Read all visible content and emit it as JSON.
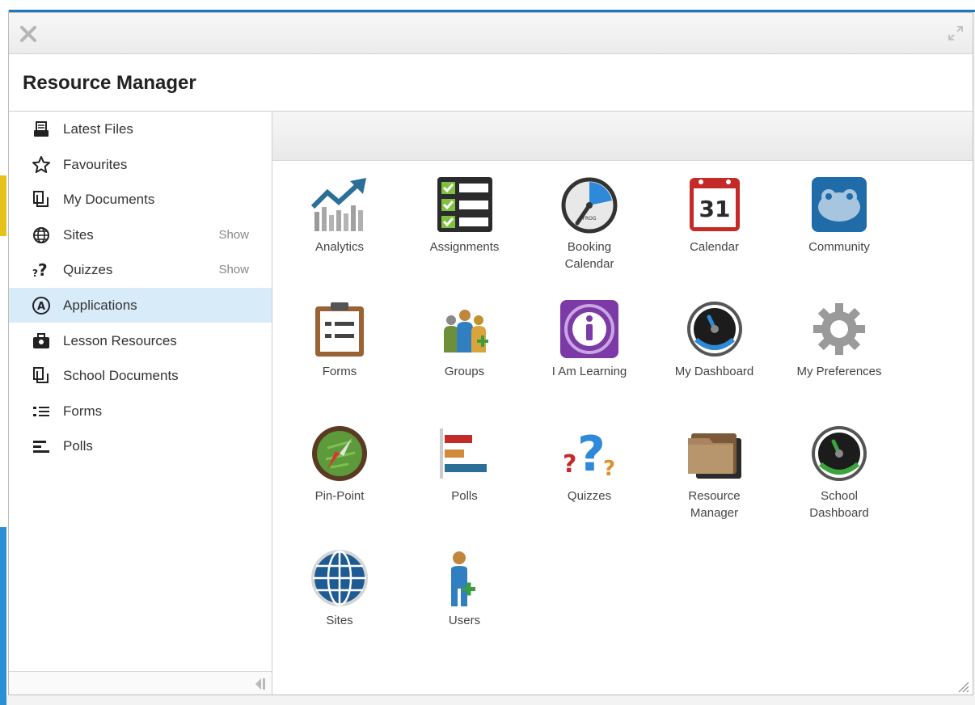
{
  "window": {
    "title": "Resource Manager"
  },
  "sidebar": {
    "items": [
      {
        "label": "Latest Files",
        "icon": "latest-files-icon"
      },
      {
        "label": "Favourites",
        "icon": "star-icon"
      },
      {
        "label": "My Documents",
        "icon": "documents-icon"
      },
      {
        "label": "Sites",
        "icon": "globe-icon",
        "action": "Show"
      },
      {
        "label": "Quizzes",
        "icon": "quiz-icon",
        "action": "Show"
      },
      {
        "label": "Applications",
        "icon": "applications-icon",
        "active": true
      },
      {
        "label": "Lesson Resources",
        "icon": "briefcase-icon"
      },
      {
        "label": "School Documents",
        "icon": "documents-icon"
      },
      {
        "label": "Forms",
        "icon": "list-icon"
      },
      {
        "label": "Polls",
        "icon": "polls-icon"
      }
    ]
  },
  "apps": [
    {
      "label": "Analytics",
      "icon": "analytics-icon"
    },
    {
      "label": "Assignments",
      "icon": "assignments-icon"
    },
    {
      "label": "Booking Calendar",
      "icon": "booking-calendar-icon"
    },
    {
      "label": "Calendar",
      "icon": "calendar-icon",
      "badge": "31"
    },
    {
      "label": "Community",
      "icon": "community-icon"
    },
    {
      "label": "Forms",
      "icon": "forms-icon"
    },
    {
      "label": "Groups",
      "icon": "groups-icon"
    },
    {
      "label": "I Am Learning",
      "icon": "i-am-learning-icon"
    },
    {
      "label": "My Dashboard",
      "icon": "my-dashboard-icon"
    },
    {
      "label": "My Preferences",
      "icon": "gear-icon"
    },
    {
      "label": "Pin-Point",
      "icon": "compass-icon"
    },
    {
      "label": "Polls",
      "icon": "polls-icon"
    },
    {
      "label": "Quizzes",
      "icon": "quizzes-icon"
    },
    {
      "label": "Resource Manager",
      "icon": "folder-icon"
    },
    {
      "label": "School Dashboard",
      "icon": "school-dashboard-icon"
    },
    {
      "label": "Sites",
      "icon": "globe-icon"
    },
    {
      "label": "Users",
      "icon": "add-user-icon"
    }
  ],
  "colors": {
    "active_row": "#d8ebf8",
    "accent": "#1e79c3"
  }
}
